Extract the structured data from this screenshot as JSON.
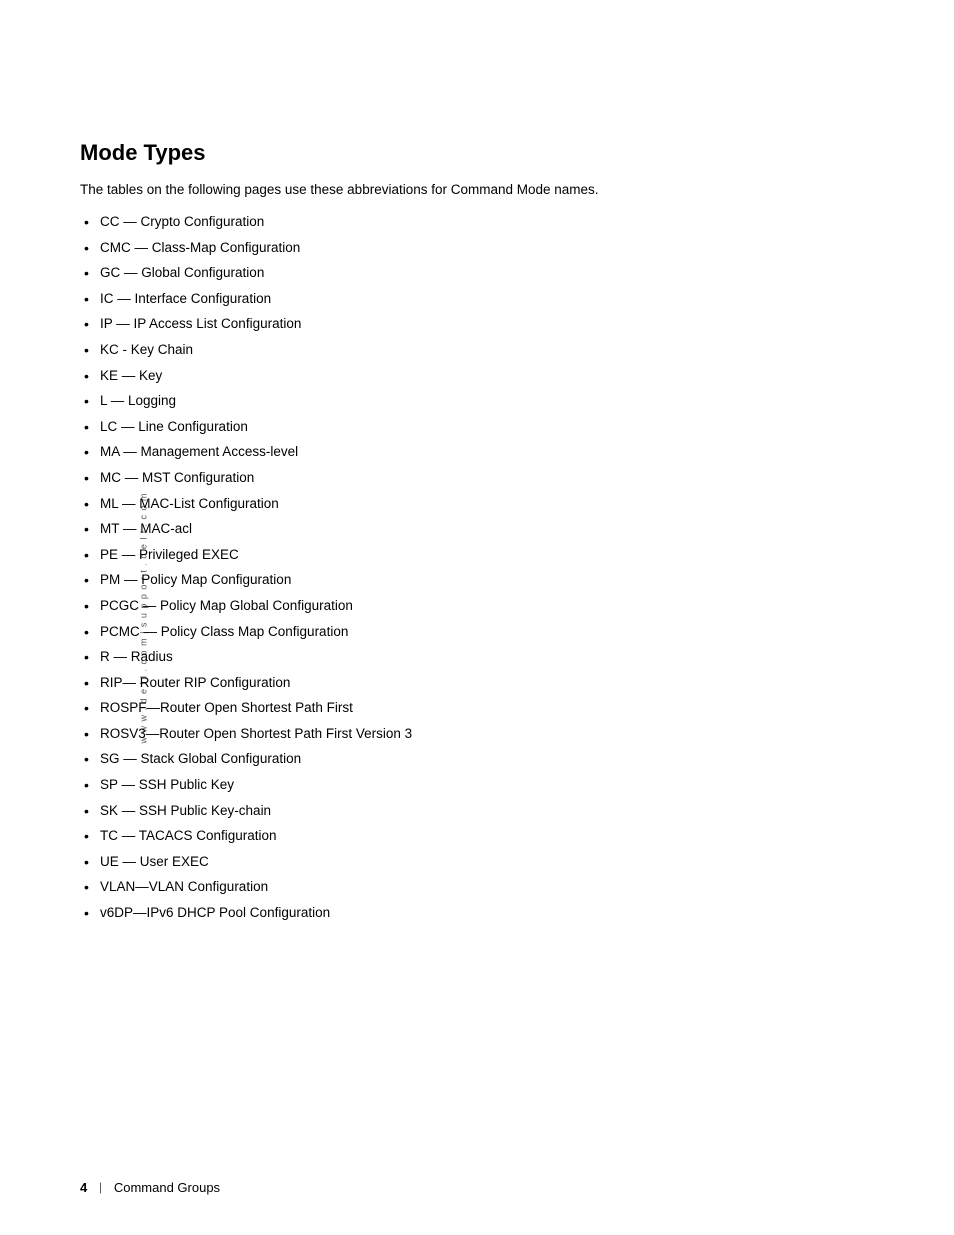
{
  "side_text": "w w w . d e l l . c o m   |   s u p p o r t . d e l l . c o m",
  "page": {
    "title": "Mode Types",
    "intro": "The tables on the following pages use these abbreviations for Command Mode names.",
    "bullet_items": [
      "CC — Crypto Configuration",
      "CMC — Class-Map Configuration",
      "GC — Global Configuration",
      "IC — Interface Configuration",
      "IP — IP Access List Configuration",
      "KC - Key Chain",
      "KE — Key",
      "L — Logging",
      "LC — Line Configuration",
      "MA — Management Access-level",
      "MC — MST Configuration",
      "ML — MAC-List Configuration",
      "MT — MAC-acl",
      "PE — Privileged EXEC",
      "PM — Policy Map Configuration",
      "PCGC — Policy Map Global Configuration",
      "PCMC — Policy Class Map Configuration",
      "R — Radius",
      "RIP— Router RIP Configuration",
      "ROSPF—Router Open Shortest Path First",
      "ROSV3—Router Open Shortest Path First Version 3",
      "SG — Stack Global Configuration",
      "SP — SSH Public Key",
      "SK — SSH Public Key-chain",
      "TC — TACACS Configuration",
      "UE — User EXEC",
      "VLAN—VLAN Configuration",
      "v6DP—IPv6 DHCP Pool Configuration"
    ]
  },
  "footer": {
    "page_number": "4",
    "separator": "|",
    "section_name": "Command Groups"
  }
}
